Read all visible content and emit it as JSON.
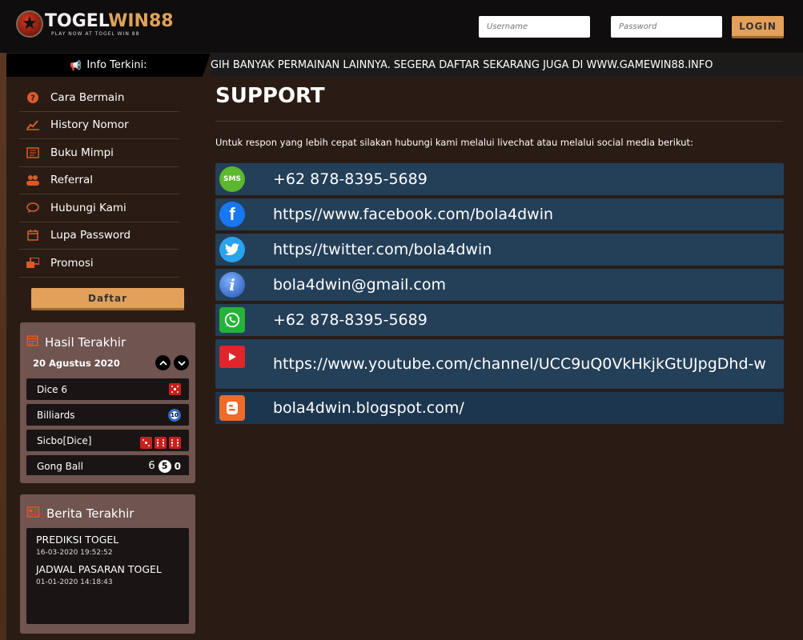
{
  "header": {
    "logo_main_a": "TOGEL",
    "logo_main_b": "WIN88",
    "logo_sub": "PLAY NOW AT TOGEL WIN 88",
    "username_placeholder": "Username",
    "password_placeholder": "Password",
    "login_label": "LOGIN"
  },
  "info": {
    "label": "Info Terkini:",
    "marquee": "GIH BANYAK PERMAINAN LAINNYA. SEGERA DAFTAR SEKARANG JUGA DI WWW.GAMEWIN88.INFO"
  },
  "menu": {
    "items": [
      {
        "label": "Cara Bermain",
        "icon": "question-icon"
      },
      {
        "label": "History Nomor",
        "icon": "chart-line-icon"
      },
      {
        "label": "Buku Mimpi",
        "icon": "book-icon"
      },
      {
        "label": "Referral",
        "icon": "users-icon"
      },
      {
        "label": "Hubungi Kami",
        "icon": "chat-icon"
      },
      {
        "label": "Lupa Password",
        "icon": "calendar-icon"
      },
      {
        "label": "Promosi",
        "icon": "windows-icon"
      }
    ],
    "daftar_label": "Daftar"
  },
  "hasil": {
    "title": "Hasil Terakhir",
    "date": "20 Agustus 2020",
    "rows": [
      {
        "name": "Dice 6",
        "result_type": "die"
      },
      {
        "name": "Billiards",
        "result": "10"
      },
      {
        "name": "Sicbo[Dice]",
        "result_type": "dice3"
      },
      {
        "name": "Gong Ball",
        "result_a": "6",
        "result_b": "5",
        "result_c": "0"
      }
    ]
  },
  "berita": {
    "title": "Berita Terakhir",
    "items": [
      {
        "title": "PREDIKSI TOGEL",
        "date": "16-03-2020 19:52:52"
      },
      {
        "title": "JADWAL PASARAN TOGEL",
        "date": "01-01-2020 14:18:43"
      }
    ]
  },
  "support": {
    "title": "SUPPORT",
    "intro": "Untuk respon yang lebih cepat silakan hubungi kami melalui livechat atau melalui social media berikut:",
    "contacts": [
      {
        "type": "sms",
        "text": "+62 878-8395-5689",
        "icon": "sms-icon",
        "icon_label": "SMS",
        "color": "#5cb82e"
      },
      {
        "type": "facebook",
        "text": "https//www.facebook.com/bola4dwin",
        "icon": "facebook-icon",
        "icon_label": "f",
        "color": "#1877f2"
      },
      {
        "type": "twitter",
        "text": "https//twitter.com/bola4dwin",
        "icon": "twitter-icon",
        "color": "#2aa3ef"
      },
      {
        "type": "email",
        "text": "bola4dwin@gmail.com",
        "icon": "info-icon",
        "icon_label": "i",
        "color": "#3a6fc8"
      },
      {
        "type": "whatsapp",
        "text": "+62 878-8395-5689",
        "icon": "whatsapp-icon",
        "color": "#25b33a"
      },
      {
        "type": "youtube",
        "text": "https://www.youtube.com/channel/UCC9uQ0VkHkjkGtUJpgDhd-w",
        "icon": "youtube-icon",
        "color": "#e0262a"
      },
      {
        "type": "blogger",
        "text": "bola4dwin.blogspot.com/",
        "icon": "blogger-icon",
        "color": "#f06a2a"
      }
    ]
  }
}
